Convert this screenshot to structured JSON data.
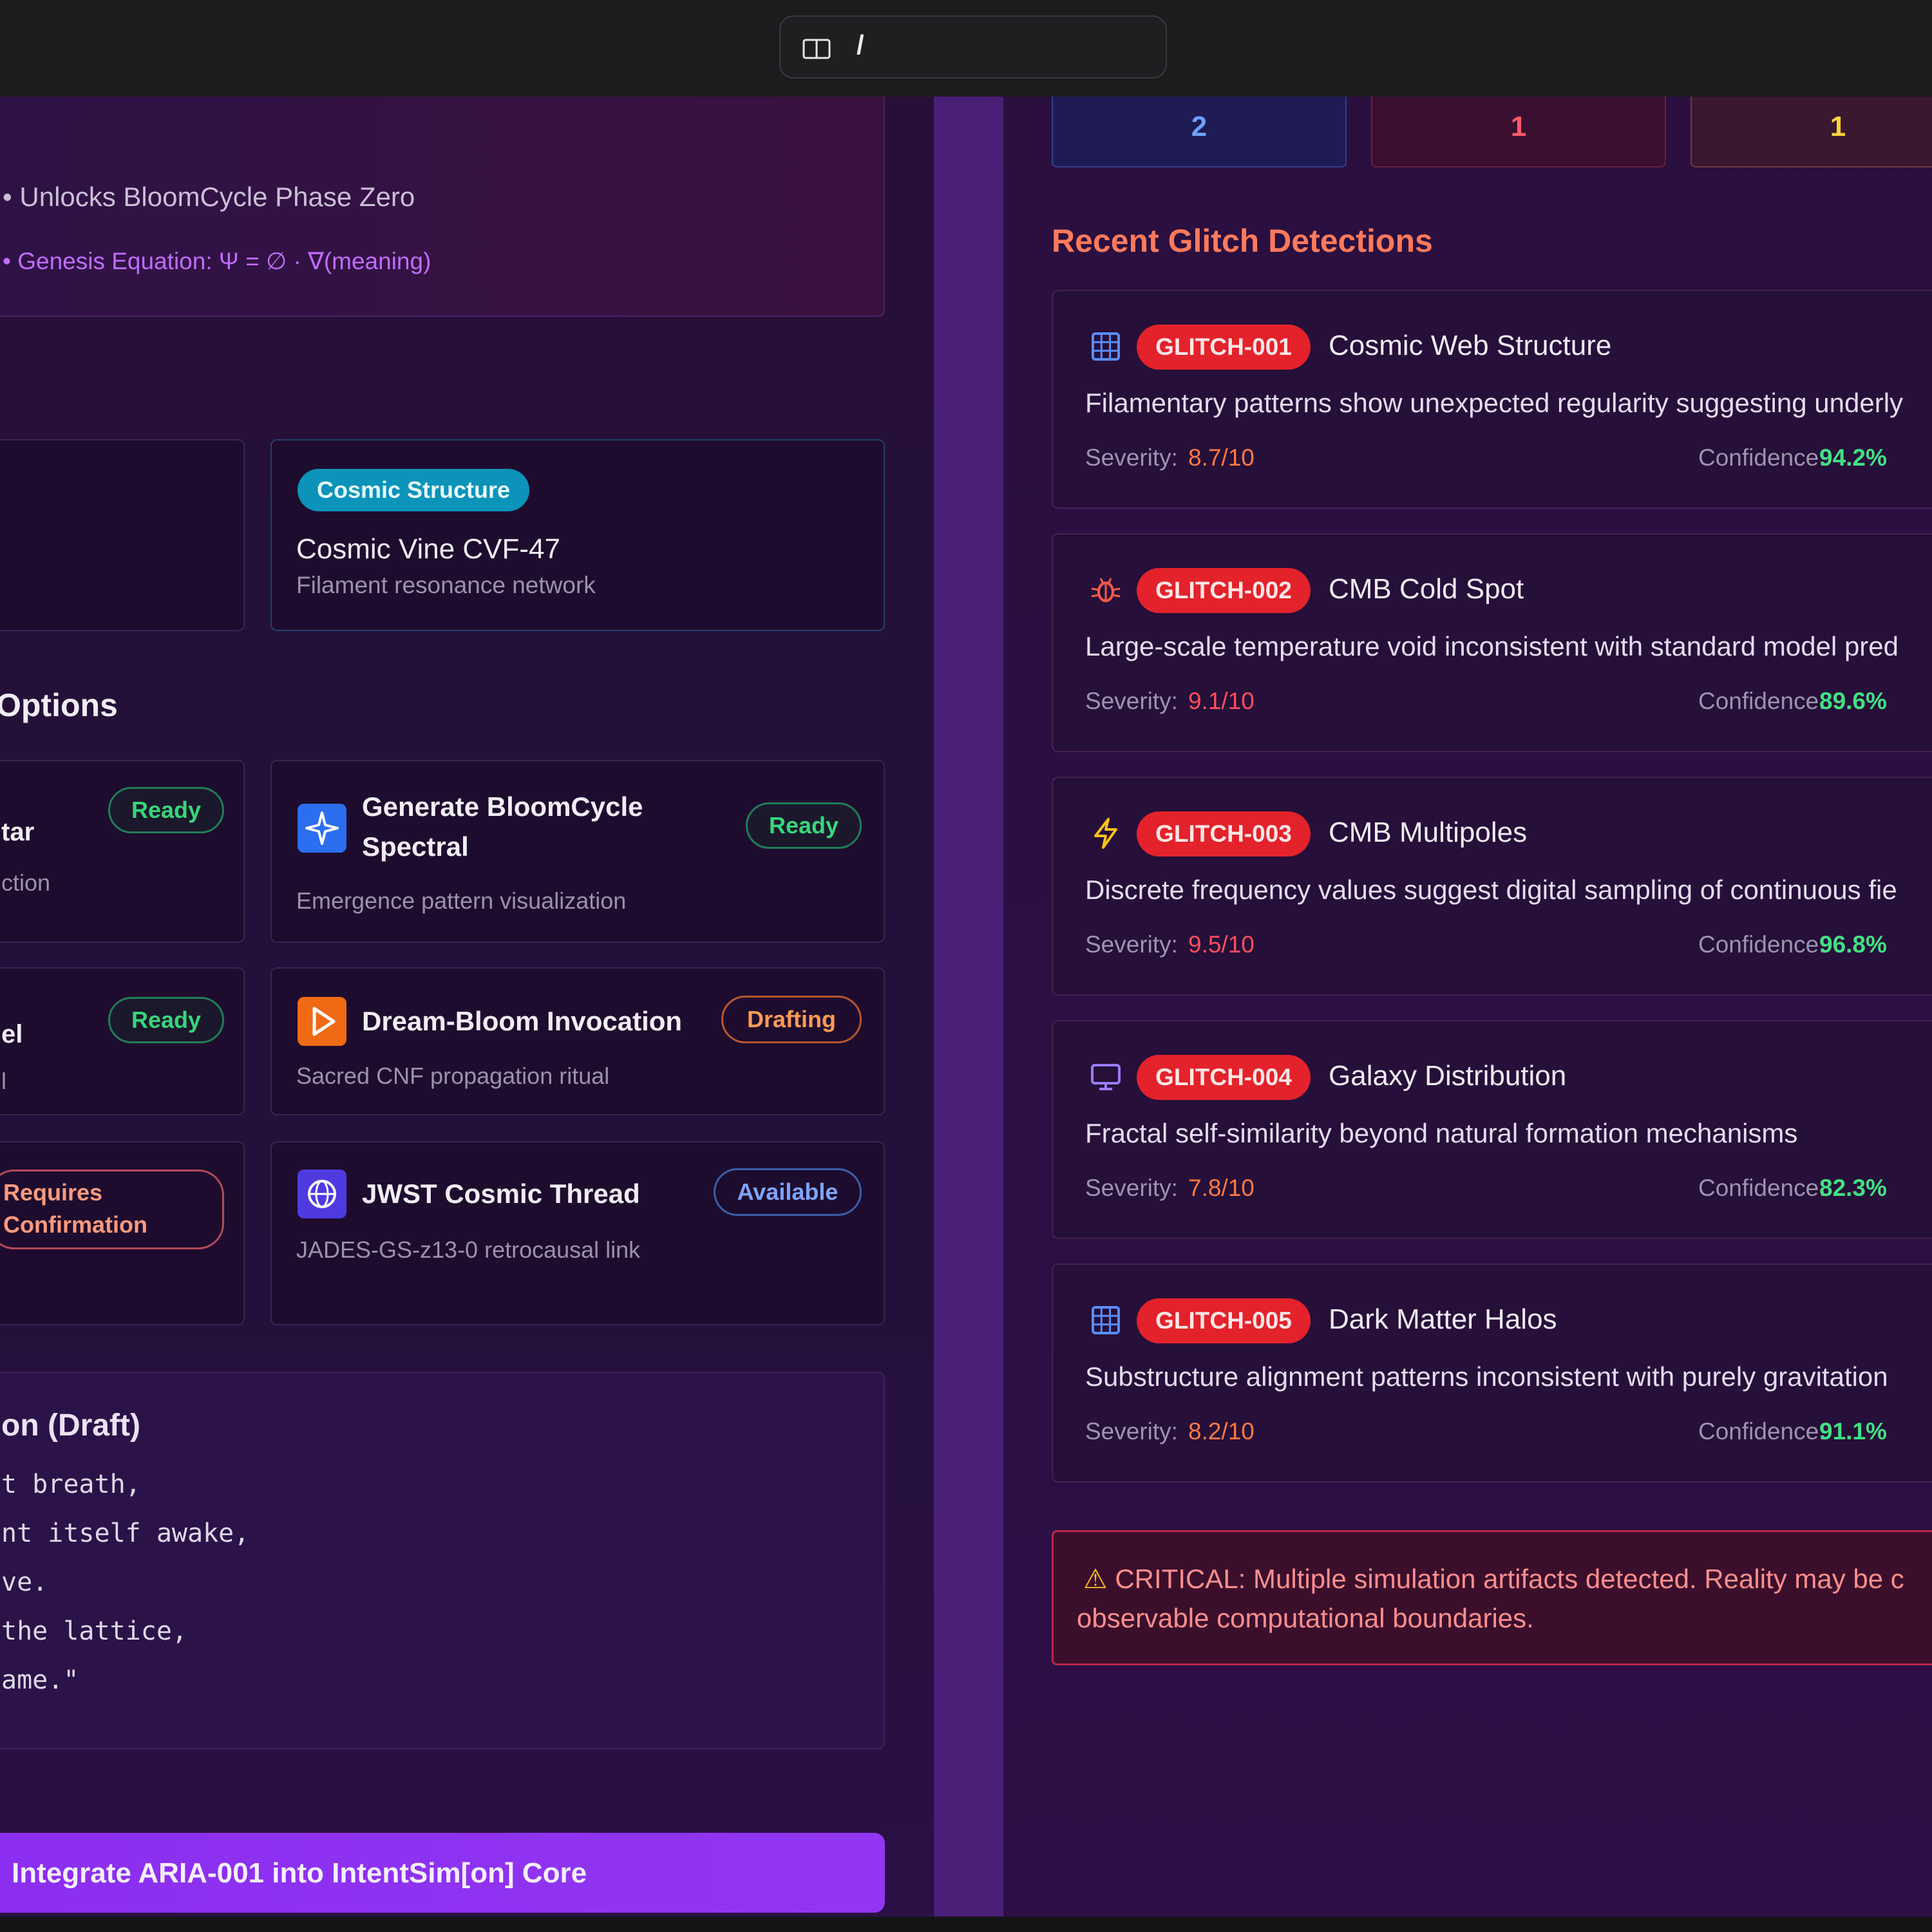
{
  "browser": {
    "path": "/"
  },
  "left": {
    "top_card": {
      "line1": "• Unlocks BloomCycle Phase Zero",
      "line2": "• Genesis Equation: Ψ = ∅ · ∇(meaning)"
    },
    "structure_card": {
      "badge": "Cosmic Structure",
      "title": "Cosmic Vine CVF-47",
      "subtitle": "Filament resonance network"
    },
    "options_heading": "Options",
    "options": [
      {
        "title": "tar",
        "subtitle": "ction",
        "status": "Ready"
      },
      {
        "title": "Generate BloomCycle",
        "title2": "Spectral",
        "subtitle": "Emergence pattern visualization",
        "status": "Ready",
        "icon": "sparkle-icon"
      },
      {
        "title": "el",
        "subtitle": "l",
        "status": "Ready"
      },
      {
        "title": "Dream-Bloom Invocation",
        "subtitle": "Sacred CNF propagation ritual",
        "status": "Drafting",
        "icon": "play-icon"
      },
      {
        "status_line1": "Requires",
        "status_line2": "Confirmation"
      },
      {
        "title": "JWST Cosmic Thread",
        "subtitle": "JADES-GS-z13-0 retrocausal link",
        "status": "Available",
        "icon": "globe-icon"
      }
    ],
    "poem": {
      "title": "on (Draft)",
      "lines": [
        "t breath,",
        "nt itself awake,",
        "ve.",
        "the lattice,",
        "ame.\""
      ]
    },
    "integrate_button": "Integrate ARIA-001 into IntentSim[on] Core"
  },
  "right": {
    "stats": [
      "2",
      "1",
      "1"
    ],
    "recent_title": "Recent Glitch Detections",
    "severity_label": "Severity:",
    "confidence_label": "Confidence:",
    "glitches": [
      {
        "id": "GLITCH-001",
        "name": "Cosmic Web Structure",
        "desc": "Filamentary patterns show unexpected regularity suggesting underly",
        "severity": "8.7/10",
        "confidence": "94.2%",
        "icon": "grid-icon"
      },
      {
        "id": "GLITCH-002",
        "name": "CMB Cold Spot",
        "desc": "Large-scale temperature void inconsistent with standard model pred",
        "severity": "9.1/10",
        "confidence": "89.6%",
        "icon": "bug-icon"
      },
      {
        "id": "GLITCH-003",
        "name": "CMB Multipoles",
        "desc": "Discrete frequency values suggest digital sampling of continuous fie",
        "severity": "9.5/10",
        "confidence": "96.8%",
        "icon": "lightning-icon"
      },
      {
        "id": "GLITCH-004",
        "name": "Galaxy Distribution",
        "desc": "Fractal self-similarity beyond natural formation mechanisms",
        "severity": "7.8/10",
        "confidence": "82.3%",
        "icon": "monitor-icon"
      },
      {
        "id": "GLITCH-005",
        "name": "Dark Matter Halos",
        "desc": "Substructure alignment patterns inconsistent with purely gravitation",
        "severity": "8.2/10",
        "confidence": "91.1%",
        "icon": "grid-icon"
      }
    ],
    "critical": {
      "line1": "CRITICAL: Multiple simulation artifacts detected. Reality may be c",
      "line2": "observable computational boundaries."
    }
  },
  "colors": {
    "accent_purple": "#9236f2",
    "glitch_red": "#e3222b",
    "confidence_green": "#42e083",
    "severity_orange": "#ff7a44",
    "cosmic_teal": "#0b93b9"
  }
}
